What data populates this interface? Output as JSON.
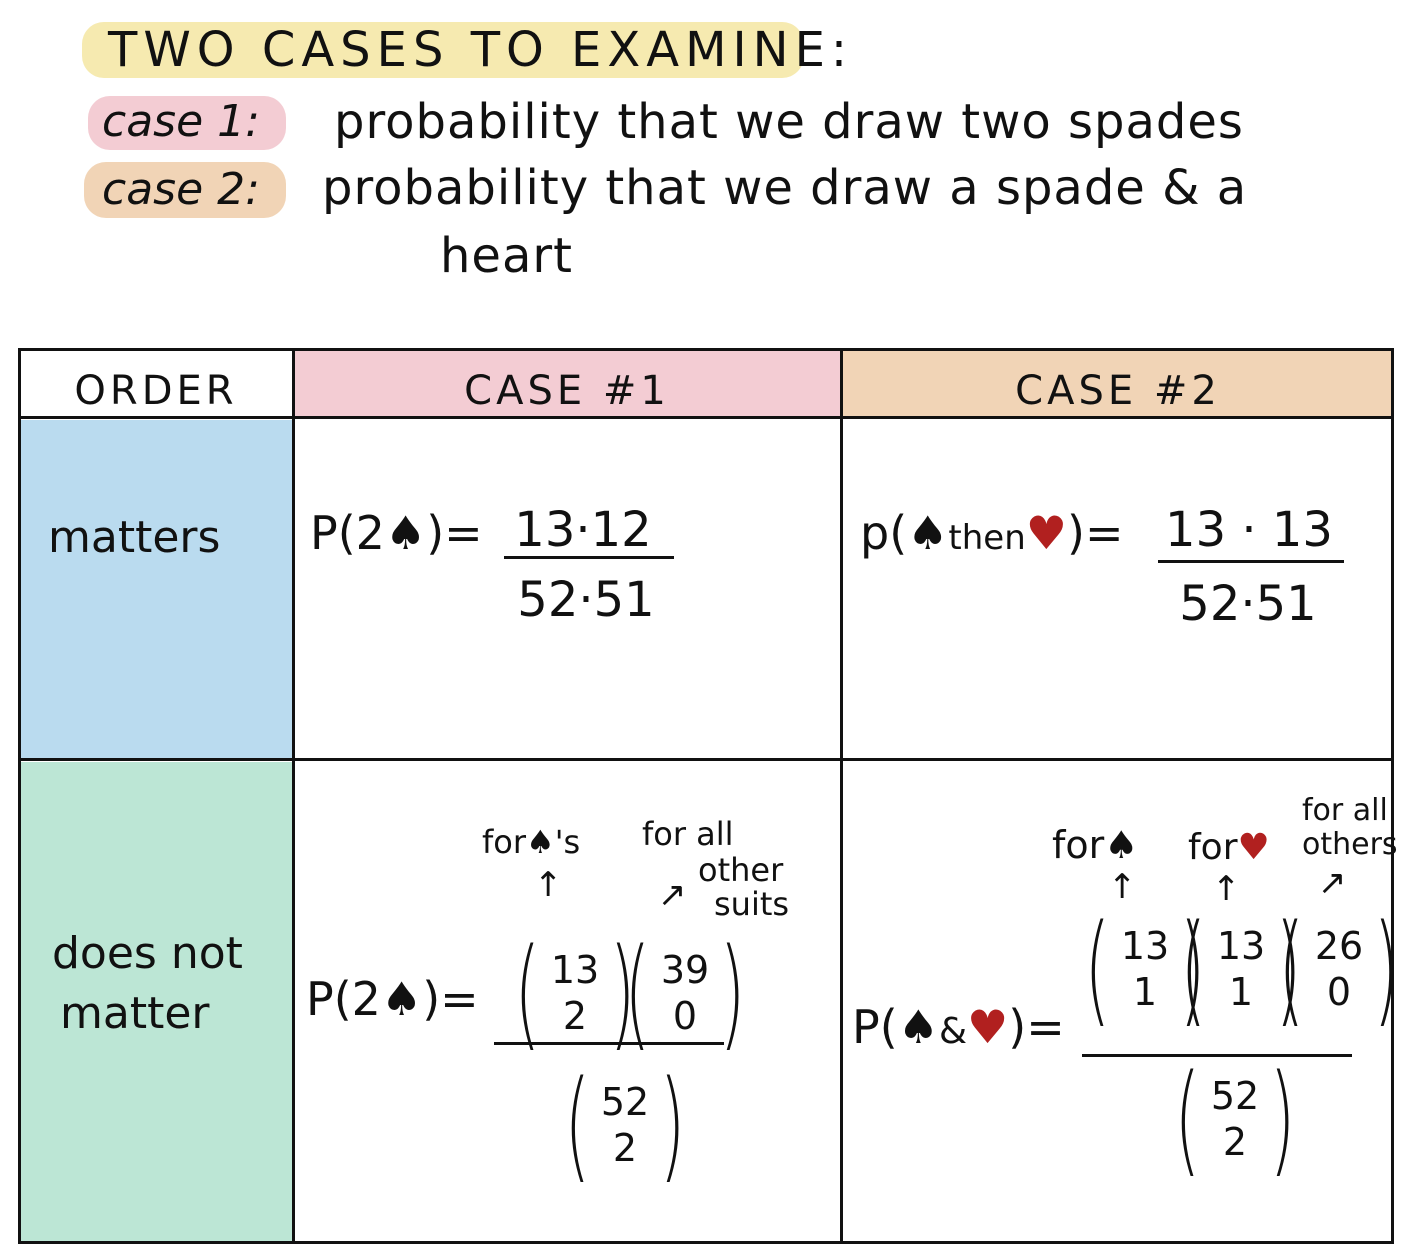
{
  "header": {
    "title": "TWO CASES TO EXAMINE:",
    "case1_label": "case 1:",
    "case1_desc": "probability that we draw two spades",
    "case2_label": "case 2:",
    "case2_desc_line1": "probability that we draw a spade & a",
    "case2_desc_line2": "heart"
  },
  "colors": {
    "title_highlight": "#f6eab0",
    "case1": "#f3ccd3",
    "case2": "#f1d4b6",
    "matters": "#badbef",
    "does_not_matter": "#bce6d5",
    "heart": "#b1201f"
  },
  "table": {
    "col_headers": [
      "ORDER",
      "CASE #1",
      "CASE #2"
    ],
    "rows": [
      "matters",
      "does not matter"
    ],
    "row2_line1": "does not",
    "row2_line2": "matter"
  },
  "cells": {
    "c1_matters": {
      "lhs_prefix": "P(2",
      "lhs_suffix": ")=",
      "num": "13·12",
      "den": "52·51"
    },
    "c2_matters": {
      "lhs_prefix": "p(",
      "lhs_mid": "then",
      "lhs_suffix": ")=",
      "num": "13 · 13",
      "den": "52·51"
    },
    "c1_notmatter": {
      "lhs_prefix": "P(2",
      "lhs_suffix": ")=",
      "note_a_prefix": "for",
      "note_a_suffix": "'s",
      "note_b_line1": "for all",
      "note_b_line2": "other",
      "note_b_line3": "suits",
      "binoms": [
        [
          "13",
          "2"
        ],
        [
          "39",
          "0"
        ]
      ],
      "den": [
        "52",
        "2"
      ]
    },
    "c2_notmatter": {
      "lhs_prefix": "P(",
      "lhs_mid": "&",
      "lhs_suffix": ")=",
      "note_a": "for",
      "note_b": "for",
      "note_c_line1": "for all",
      "note_c_line2": "others",
      "binoms": [
        [
          "13",
          "1"
        ],
        [
          "13",
          "1"
        ],
        [
          "26",
          "0"
        ]
      ],
      "den": [
        "52",
        "2"
      ]
    }
  },
  "icons": {
    "spade": "spade-icon",
    "heart": "heart-icon",
    "arrow": "up-arrow-icon"
  }
}
